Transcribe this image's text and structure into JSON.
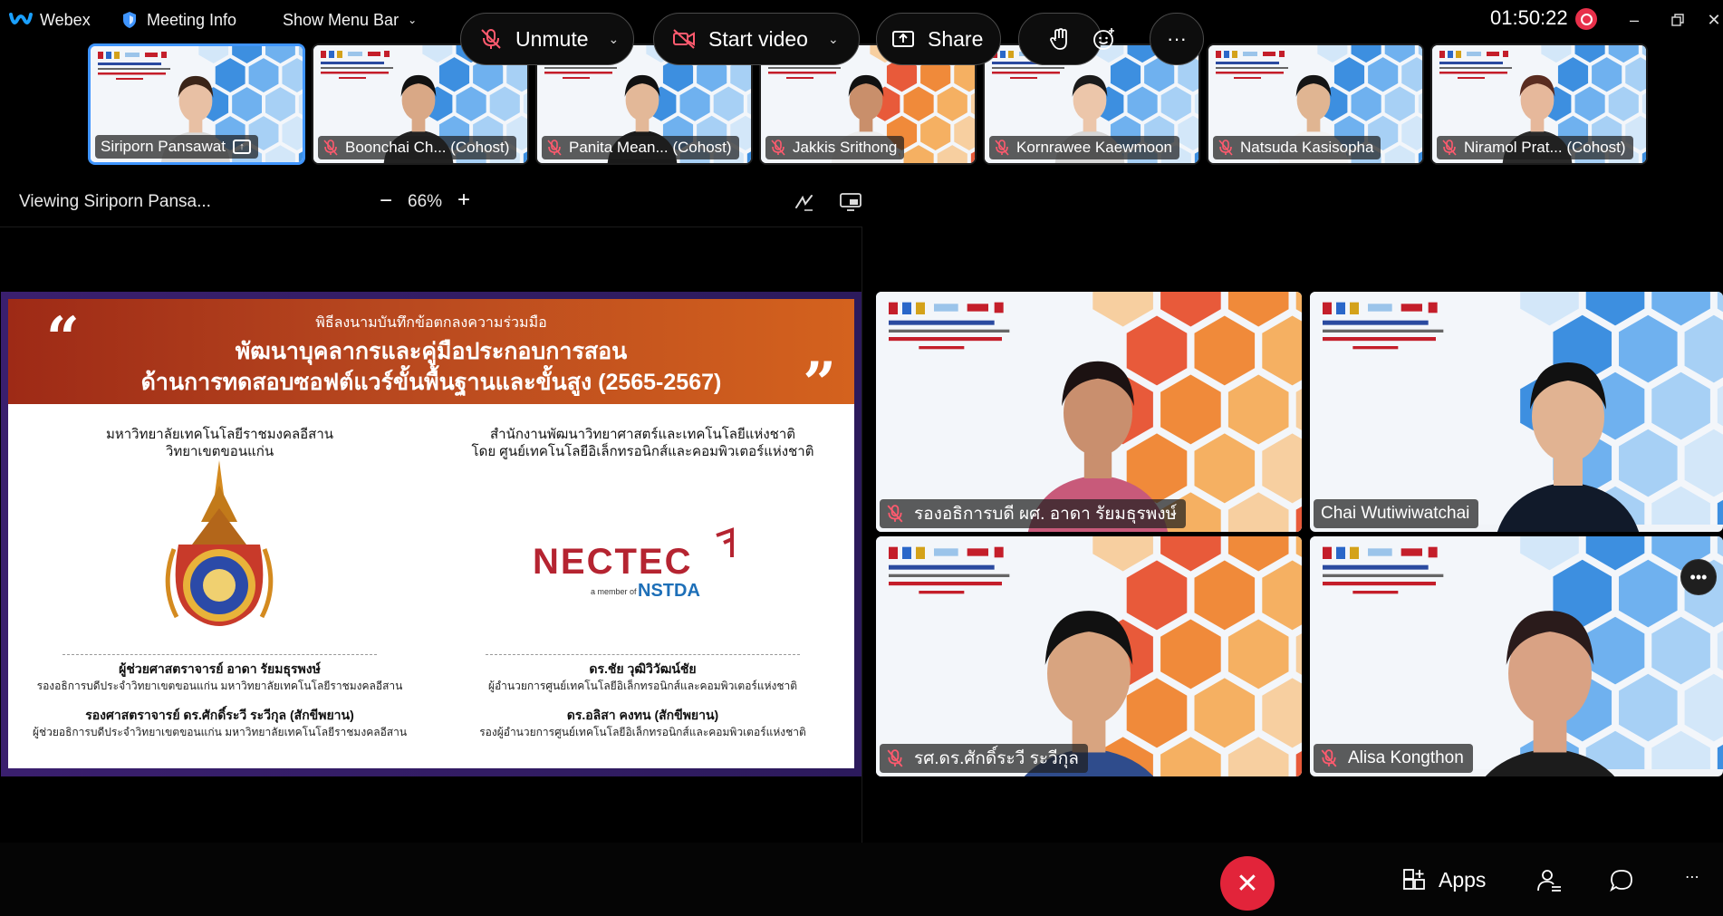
{
  "topbar": {
    "app_name": "Webex",
    "meeting_info": "Meeting Info",
    "show_menu_bar": "Show Menu Bar",
    "clock": "01:50:22",
    "colors": {
      "accent": "#3f95ff",
      "record": "#e8304a"
    }
  },
  "filmstrip": [
    {
      "name": "Siriporn Pansawat",
      "muted": false,
      "sharing": true,
      "active": true,
      "palette": "blue"
    },
    {
      "name": "Boonchai Ch... (Cohost)",
      "muted": true,
      "palette": "blue"
    },
    {
      "name": "Panita Mean... (Cohost)",
      "muted": true,
      "palette": "blue"
    },
    {
      "name": "Jakkis Srithong",
      "muted": true,
      "palette": "orange"
    },
    {
      "name": "Kornrawee Kaewmoon",
      "muted": true,
      "palette": "blue"
    },
    {
      "name": "Natsuda Kasisopha",
      "muted": true,
      "palette": "blue"
    },
    {
      "name": "Niramol Prat... (Cohost)",
      "muted": true,
      "palette": "blue"
    }
  ],
  "share": {
    "viewing": "Viewing Siriporn Pansa...",
    "zoom": "66%",
    "zoom_minus": "−",
    "zoom_plus": "+"
  },
  "slide": {
    "subtitle": "พิธีลงนามบันทึกข้อตกลงความร่วมมือ",
    "title1": "พัฒนาบุคลากรและคู่มือประกอบการสอน",
    "title2": "ด้านการทดสอบซอฟต์แวร์ขั้นพื้นฐานและขั้นสูง (2565-2567)",
    "quote_open": "“",
    "quote_close": "”",
    "left": {
      "org_line1": "มหาวิทยาลัยเทคโนโลยีราชมงคลอีสาน",
      "org_line2": "วิทยาเขตขอนแก่น",
      "signer1_name": "ผู้ช่วยศาสตราจารย์ อาดา รัยมธุรพงษ์",
      "signer1_role": "รองอธิการบดีประจำวิทยาเขตขอนแก่น   มหาวิทยาลัยเทคโนโลยีราชมงคลอีสาน",
      "signer2_name": "รองศาสตราจารย์ ดร.ศักดิ์ระวี ระวีกุล (สักขีพยาน)",
      "signer2_role": "ผู้ช่วยอธิการบดีประจำวิทยาเขตขอนแก่น มหาวิทยาลัยเทคโนโลยีราชมงคลอีสาน"
    },
    "right": {
      "org_line1": "สำนักงานพัฒนาวิทยาศาสตร์และเทคโนโลยีแห่งชาติ",
      "org_line2": "โดย ศูนย์เทคโนโลยีอิเล็กทรอนิกส์และคอมพิวเตอร์แห่งชาติ",
      "logo_text": "NECTEC",
      "logo_sub_prefix": "a member of",
      "logo_sub": "NSTDA",
      "signer1_name": "ดร.ชัย วุฒิวิวัฒน์ชัย",
      "signer1_role": "ผู้อำนวยการศูนย์เทคโนโลยีอิเล็กทรอนิกส์และคอมพิวเตอร์แห่งชาติ",
      "signer2_name": "ดร.อลิสา คงทน (สักขีพยาน)",
      "signer2_role": "รองผู้อำนวยการศูนย์เทคโนโลยีอิเล็กทรอนิกส์และคอมพิวเตอร์แห่งชาติ"
    }
  },
  "grid": [
    {
      "name": "รองอธิการบดี ผศ. อาดา รัยมธุรพงษ์",
      "muted": true
    },
    {
      "name": "Chai Wutiwiwatchai",
      "muted": false
    },
    {
      "name": "รศ.ดร.ศักดิ์ระวี ระวีกุล",
      "muted": true
    },
    {
      "name": "Alisa Kongthon",
      "muted": true
    }
  ],
  "controls": {
    "unmute": "Unmute",
    "start_video": "Start video",
    "share": "Share",
    "apps": "Apps",
    "more": "···",
    "end": "✕"
  }
}
